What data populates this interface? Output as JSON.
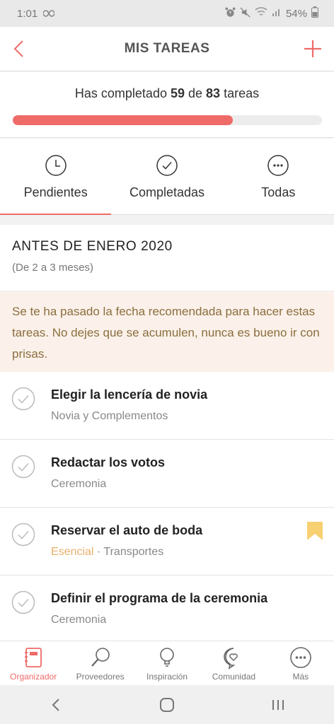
{
  "status_bar": {
    "time": "1:01",
    "extra_icon": "infinity-icon",
    "battery": "54%"
  },
  "header": {
    "title": "MIS TAREAS",
    "back_icon": "chevron-left-icon",
    "add_icon": "plus-icon"
  },
  "progress": {
    "prefix": "Has completado ",
    "done": "59",
    "of": " de ",
    "total": "83",
    "suffix": " tareas",
    "fraction": 0.711
  },
  "tabs": [
    {
      "label": "Pendientes",
      "icon": "clock-icon",
      "active": true
    },
    {
      "label": "Completadas",
      "icon": "check-circle-icon",
      "active": false
    },
    {
      "label": "Todas",
      "icon": "more-circle-icon",
      "active": false
    }
  ],
  "section": {
    "title": "ANTES DE ENERO 2020",
    "subtitle": "(De 2 a 3 meses)"
  },
  "warning": {
    "text": "Se te ha pasado la fecha recomendada para hacer estas tareas. No dejes que se acumulen, nunca es bueno ir con prisas."
  },
  "tasks": [
    {
      "title": "Elegir la lencería de novia",
      "category": "Novia y Complementos",
      "tag": "",
      "bookmarked": false
    },
    {
      "title": "Redactar los votos",
      "category": "Ceremonia",
      "tag": "",
      "bookmarked": false
    },
    {
      "title": "Reservar el auto de boda",
      "category": "Transportes",
      "tag": "Esencial",
      "separator": " · ",
      "bookmarked": true
    },
    {
      "title": "Definir el programa de la ceremonia",
      "category": "Ceremonia",
      "tag": "",
      "bookmarked": false
    }
  ],
  "bottom_nav": [
    {
      "label": "Organizador",
      "icon": "planner-icon",
      "active": true
    },
    {
      "label": "Proveedores",
      "icon": "magnifier-icon",
      "active": false
    },
    {
      "label": "Inspiración",
      "icon": "lightbulb-icon",
      "active": false
    },
    {
      "label": "Comunidad",
      "icon": "chat-heart-icon",
      "active": false
    },
    {
      "label": "Más",
      "icon": "more-icon",
      "active": false
    }
  ],
  "colors": {
    "accent": "#ee6b68",
    "essential": "#e7b06a",
    "bookmark": "#f7d071",
    "warning_bg": "#fbf1ea",
    "warning_text": "#8b6e3e"
  }
}
